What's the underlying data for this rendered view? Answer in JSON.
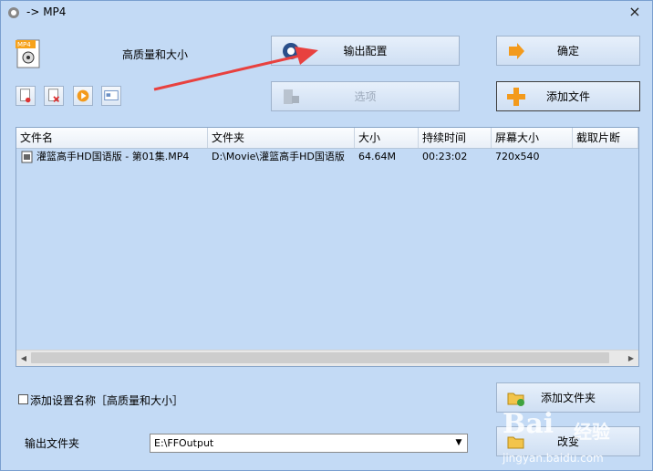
{
  "window": {
    "title": "-> MP4",
    "close_glyph": "×"
  },
  "format": {
    "badge_text": "MP4",
    "quality_label": "高质量和大小"
  },
  "buttons": {
    "output_config": "输出配置",
    "ok": "确定",
    "options": "选项",
    "add_file": "添加文件",
    "add_folder": "添加文件夹",
    "change": "改变"
  },
  "tools": [
    "remove-icon",
    "clear-icon",
    "play-icon",
    "info-icon"
  ],
  "table": {
    "columns": [
      "文件名",
      "文件夹",
      "大小",
      "持续时间",
      "屏幕大小",
      "截取片断"
    ],
    "rows": [
      {
        "name": "灌篮高手HD国语版 - 第01集.MP4",
        "folder": "D:\\Movie\\灌篮高手HD国语版",
        "size": "64.64M",
        "duration": "00:23:02",
        "screen": "720x540",
        "clip": ""
      }
    ]
  },
  "settings": {
    "add_name_label": "添加设置名称［高质量和大小］",
    "output_folder_label": "输出文件夹",
    "output_folder_value": "E:\\FFOutput"
  },
  "watermark": {
    "brand": "Bai",
    "cn": "经验",
    "url": "jingyan.baidu.com"
  },
  "colors": {
    "background": "#c3daf5",
    "arrow": "#e8413f",
    "accent_orange": "#f39a1c"
  }
}
